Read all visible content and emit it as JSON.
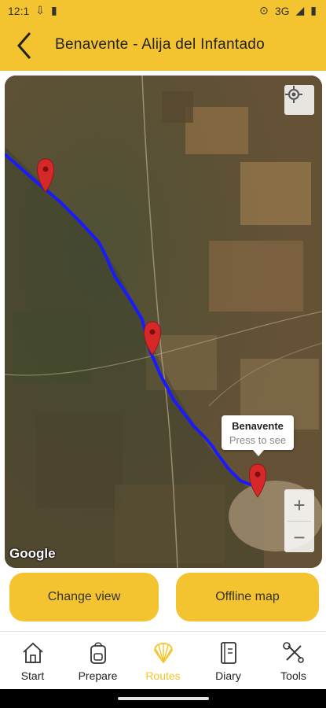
{
  "status": {
    "time": "12:1",
    "network": "3G"
  },
  "header": {
    "title": "Benavente - Alija del Infantado"
  },
  "map": {
    "attribution": "Google",
    "info_window": {
      "title": "Benavente",
      "subtitle": "Press to see"
    },
    "zoom_in": "+",
    "zoom_out": "−",
    "route_color": "#1a1aff",
    "marker_color": "#d62828"
  },
  "actions": {
    "change_view": "Change view",
    "offline_map": "Offline map"
  },
  "nav": {
    "items": [
      {
        "label": "Start",
        "icon": "house-icon"
      },
      {
        "label": "Prepare",
        "icon": "backpack-icon"
      },
      {
        "label": "Routes",
        "icon": "shell-icon",
        "active": true
      },
      {
        "label": "Diary",
        "icon": "diary-icon"
      },
      {
        "label": "Tools",
        "icon": "tools-icon"
      }
    ]
  },
  "colors": {
    "accent": "#f4c430"
  }
}
